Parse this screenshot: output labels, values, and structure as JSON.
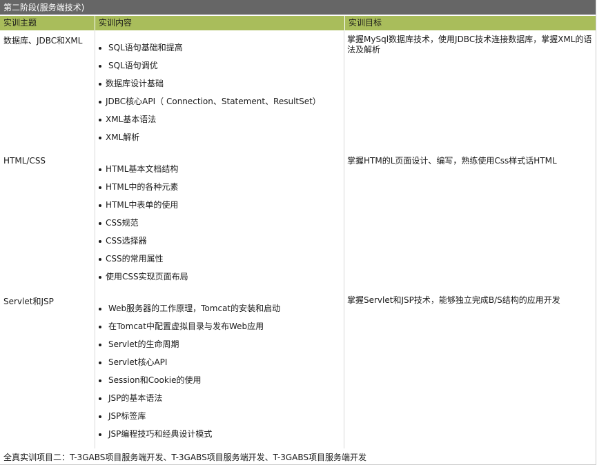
{
  "section_title": "第二阶段(服务端技术)",
  "headers": {
    "topic": "实训主题",
    "content": "实训内容",
    "goal": "实训目标"
  },
  "rows": [
    {
      "topic": "数据库、JDBC和XML",
      "items": [
        "SQL语句基础和提高",
        "SQL语句调优",
        "数据库设计基础",
        "JDBC核心API（ Connection、Statement、ResultSet）",
        "XML基本语法",
        "XML解析"
      ],
      "goal": "掌握MySql数据库技术，使用JDBC技术连接数据库，掌握XML的语法及解析"
    },
    {
      "topic": "HTML/CSS",
      "items": [
        "HTML基本文档结构",
        "HTML中的各种元素",
        "HTML中表单的使用",
        "CSS规范",
        "CSS选择器",
        "CSS的常用属性",
        "使用CSS实现页面布局"
      ],
      "goal": "掌握HTM的L页面设计、编写，熟练使用Css样式话HTML"
    },
    {
      "topic": "Servlet和JSP",
      "items": [
        "Web服务器的工作原理，Tomcat的安装和启动",
        "在Tomcat中配置虚拟目录与发布Web应用",
        "Servlet的生命周期",
        "Servlet核心API",
        "Session和Cookie的使用",
        "JSP的基本语法",
        "JSP标签库",
        "JSP编程技巧和经典设计模式"
      ],
      "goal": "掌握Servlet和JSP技术，能够独立完成B/S结构的应用开发"
    }
  ],
  "footer": "全真实训项目二：T-3GABS项目服务端开发、T-3GABS项目服务端开发、T-3GABS项目服务端开发"
}
